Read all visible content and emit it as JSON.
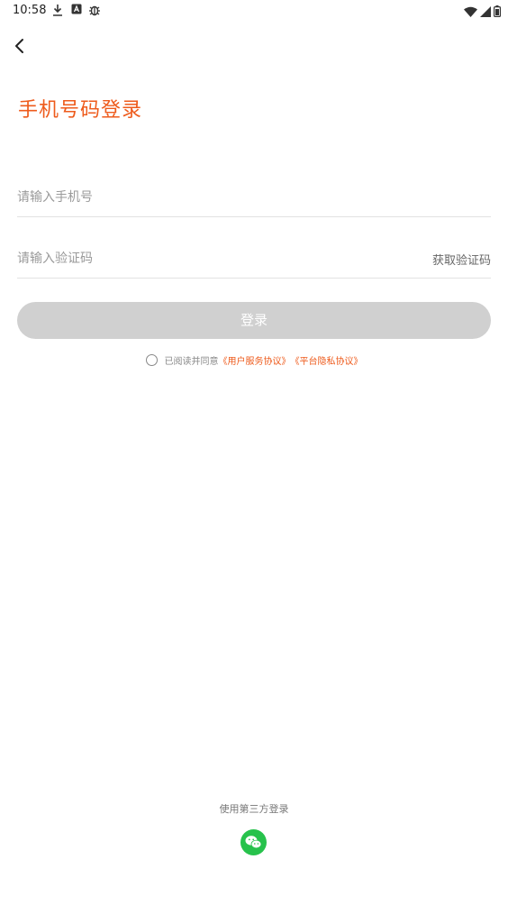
{
  "status_bar": {
    "time": "10:58"
  },
  "page": {
    "title": "手机号码登录",
    "phone_placeholder": "请输入手机号",
    "code_placeholder": "请输入验证码",
    "get_code_label": "获取验证码",
    "login_label": "登录",
    "agreement_prefix": "已阅读并同意",
    "user_agreement": "《用户服务协议》",
    "privacy_agreement": "《平台隐私协议》",
    "third_party_label": "使用第三方登录"
  },
  "colors": {
    "accent": "#ee5b1c",
    "wechat": "#27c24c",
    "button_disabled": "#d0d0d0"
  },
  "icons": [
    "back-arrow-icon",
    "download-icon",
    "a-box-icon",
    "bug-icon",
    "wifi-icon",
    "signal-icon",
    "battery-icon",
    "wechat-icon"
  ]
}
